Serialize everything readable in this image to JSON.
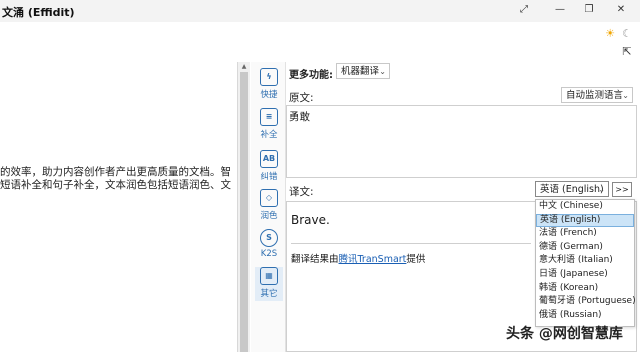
{
  "window": {
    "title": "文涌 (Effidit)",
    "controls": [
      "⤢",
      "—",
      "❐",
      "✕"
    ]
  },
  "theme": {
    "light_icon": "sun-icon",
    "dark_icon": "moon-icon",
    "share_icon": "share-icon"
  },
  "editor": {
    "lines": [
      "的效率，助力内容创作者产出更高质量的文档。智",
      "短语补全和句子补全，文本润色包括短语润色、文"
    ]
  },
  "sidebar": {
    "items": [
      {
        "label": "快捷",
        "icon": "lightning-icon",
        "glyph": "ϟ"
      },
      {
        "label": "补全",
        "icon": "document-icon",
        "glyph": "≡"
      },
      {
        "label": "纠错",
        "icon": "spellcheck-icon",
        "glyph": "AB"
      },
      {
        "label": "润色",
        "icon": "diamond-icon",
        "glyph": "◇"
      },
      {
        "label": "K2S",
        "icon": "k2s-icon",
        "glyph": "S"
      },
      {
        "label": "其它",
        "icon": "grid-icon",
        "glyph": "▦"
      }
    ]
  },
  "panel": {
    "more_label": "更多功能:",
    "more_value": "机器翻译",
    "source_label": "原文:",
    "source_lang": "自动监测语言",
    "source_text": "勇敢",
    "target_label": "译文:",
    "target_lang": "英语 (English)",
    "swap_label": ">>",
    "result_text": "Brave.",
    "credit_prefix": "翻译结果由",
    "credit_link": "腾讯TranSmart",
    "credit_suffix": "提供"
  },
  "language_menu": {
    "options": [
      "中文 (Chinese)",
      "英语 (English)",
      "法语 (French)",
      "德语 (German)",
      "意大利语 (Italian)",
      "日语 (Japanese)",
      "韩语 (Korean)",
      "葡萄牙语 (Portuguese)",
      "俄语 (Russian)"
    ],
    "selected_index": 1
  },
  "watermark": "头条 @网创智慧库",
  "colors": {
    "accent": "#2f6fb0",
    "link": "#1a5fb4",
    "selection": "#cce4f7"
  }
}
